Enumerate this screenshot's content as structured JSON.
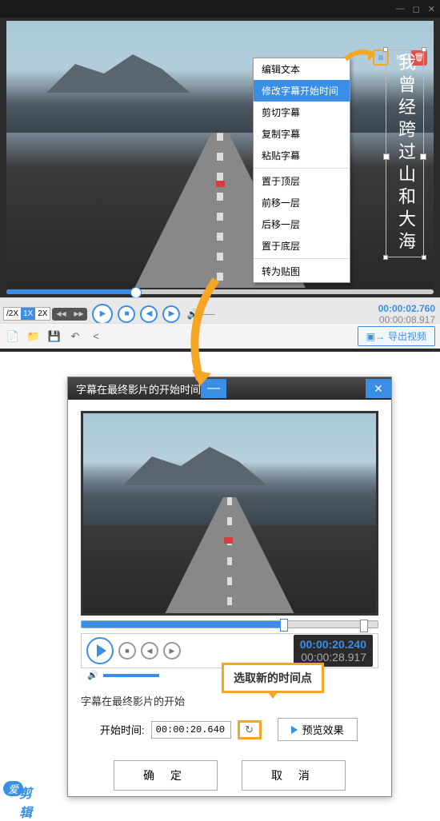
{
  "top": {
    "subtitle_text": "我曾经跨过山和大海",
    "menu": {
      "items": [
        "编辑文本",
        "修改字幕开始时间",
        "剪切字幕",
        "复制字幕",
        "粘贴字幕"
      ],
      "items2": [
        "置于顶层",
        "前移一层",
        "后移一层",
        "置于底层"
      ],
      "items3": [
        "转为贴图"
      ],
      "selected_index": 1
    },
    "speeds": [
      "/2X",
      "1X",
      "2X"
    ],
    "active_speed": 1,
    "time_current": "00:00:02.760",
    "time_total": "00:00:08.917",
    "export_label": "导出视频"
  },
  "dialog": {
    "title": "字幕在最终影片的开始时间",
    "time_current": "00:00:20.240",
    "time_total": "00:00:28.917",
    "label_prefix": "字幕在最终影片的开始",
    "callout": "选取新的时间点",
    "start_label": "开始时间:",
    "start_value": "00:00:20.640",
    "preview_label": "预览效果",
    "ok": "确 定",
    "cancel": "取 消"
  },
  "logo": {
    "badge": "爱",
    "text": "剪辑"
  }
}
